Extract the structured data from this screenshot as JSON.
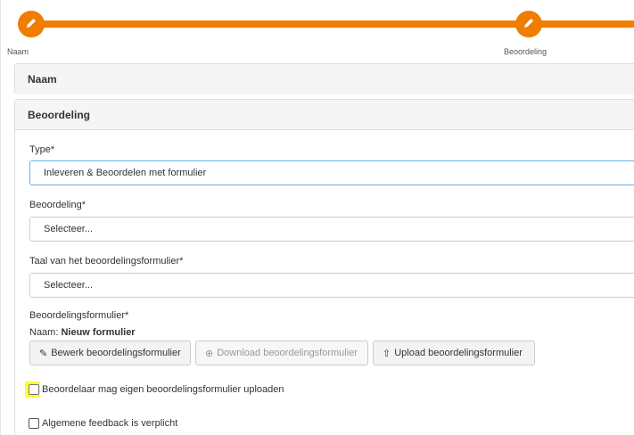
{
  "stepper": {
    "steps": [
      {
        "label": "Naam",
        "icon": "pencil-icon"
      },
      {
        "label": "Beoordeling",
        "icon": "pencil-icon"
      }
    ],
    "accent": "#ef7d00"
  },
  "panels": {
    "naam": {
      "title": "Naam"
    },
    "beoordeling": {
      "title": "Beoordeling"
    }
  },
  "form": {
    "type": {
      "label": "Type*",
      "value": "Inleveren & Beoordelen met formulier"
    },
    "beoordeling": {
      "label": "Beoordeling*",
      "value": "Selecteer..."
    },
    "taal": {
      "label": "Taal van het beoordelingsformulier*",
      "value": "Selecteer..."
    },
    "beoordelingsformulier": {
      "label": "Beoordelingsformulier*",
      "naam_prefix": "Naam:",
      "naam_value": "Nieuw formulier"
    },
    "buttons": {
      "edit": {
        "label": "Bewerk beoordelingsformulier",
        "icon": "edit-icon"
      },
      "download": {
        "label": "Download beoordelingsformulier",
        "icon": "download-icon",
        "disabled": true
      },
      "upload": {
        "label": "Upload beoordelingsformulier",
        "icon": "upload-icon"
      }
    },
    "checkboxes": {
      "eigen_formulier": {
        "label": "Beoordelaar mag eigen beoordelingsformulier uploaden",
        "checked": false
      },
      "feedback": {
        "label": "Algemene feedback is verplicht",
        "checked": false
      }
    }
  }
}
